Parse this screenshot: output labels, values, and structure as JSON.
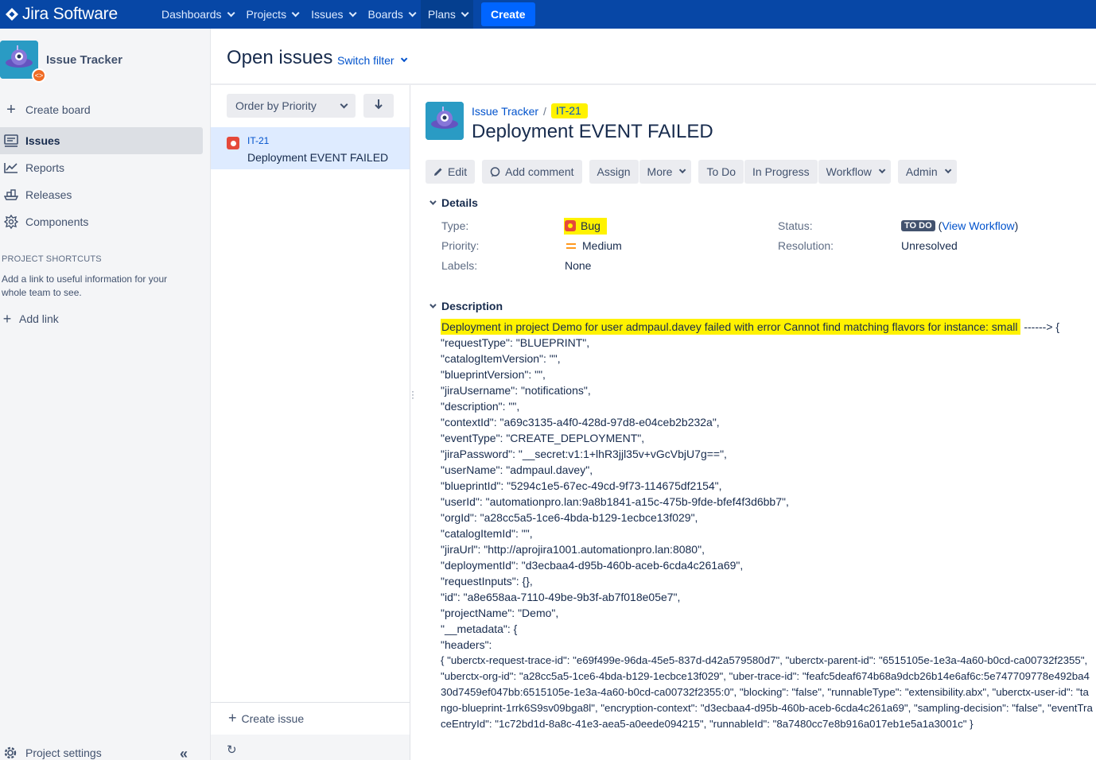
{
  "nav": {
    "brand": "Jira Software",
    "items": [
      {
        "label": "Dashboards"
      },
      {
        "label": "Projects"
      },
      {
        "label": "Issues"
      },
      {
        "label": "Boards"
      },
      {
        "label": "Plans"
      }
    ],
    "create_label": "Create"
  },
  "sidebar": {
    "project_name": "Issue Tracker",
    "create_board": "Create board",
    "items": [
      {
        "label": "Issues",
        "icon": "issues-icon"
      },
      {
        "label": "Reports",
        "icon": "reports-icon"
      },
      {
        "label": "Releases",
        "icon": "releases-icon"
      },
      {
        "label": "Components",
        "icon": "components-icon"
      }
    ],
    "shortcuts_title": "PROJECT SHORTCUTS",
    "shortcuts_text": "Add a link to useful information for your whole team to see.",
    "add_link": "Add link",
    "project_settings": "Project settings"
  },
  "header": {
    "title": "Open issues",
    "switch_filter": "Switch filter"
  },
  "list": {
    "order_by": "Order by Priority",
    "issues": [
      {
        "key": "IT-21",
        "summary": "Deployment EVENT FAILED"
      }
    ],
    "create_issue": "Create issue"
  },
  "detail": {
    "breadcrumb_project": "Issue Tracker",
    "key": "IT-21",
    "title": "Deployment EVENT FAILED",
    "toolbar": {
      "edit": "Edit",
      "add_comment": "Add comment",
      "assign": "Assign",
      "more": "More",
      "todo": "To Do",
      "in_progress": "In Progress",
      "workflow": "Workflow",
      "admin": "Admin"
    },
    "details_title": "Details",
    "fields": {
      "type_label": "Type:",
      "type_value": "Bug",
      "priority_label": "Priority:",
      "priority_value": "Medium",
      "labels_label": "Labels:",
      "labels_value": "None",
      "status_label": "Status:",
      "status_value": "TO DO",
      "view_workflow": "View Workflow",
      "resolution_label": "Resolution:",
      "resolution_value": "Unresolved"
    },
    "description_title": "Description",
    "description_first": "Deployment in project Demo for user admpaul.davey failed with error Cannot find matching flavors for instance: small",
    "description_first_tail": " ------> {",
    "description_lines": [
      "\"requestType\": \"BLUEPRINT\",",
      "\"catalogItemVersion\": \"\",",
      "\"blueprintVersion\": \"\",",
      "\"jiraUsername\": \"notifications\",",
      "\"description\": \"\",",
      "\"contextId\": \"a69c3135-a4f0-428d-97d8-e04ceb2b232a\",",
      "\"eventType\": \"CREATE_DEPLOYMENT\",",
      "\"jiraPassword\": \"__secret:v1:1+lhR3jjl35v+vGcVbjU7g==\",",
      "\"userName\": \"admpaul.davey\",",
      "\"blueprintId\": \"5294c1e5-67ec-49cd-9f73-114675df2154\",",
      "\"userId\": \"automationpro.lan:9a8b1841-a15c-475b-9fde-bfef4f3d6bb7\",",
      "\"orgId\": \"a28cc5a5-1ce6-4bda-b129-1ecbce13f029\",",
      "\"catalogItemId\": \"\",",
      "\"jiraUrl\": \"http://aprojira1001.automationpro.lan:8080\",",
      "\"deploymentId\": \"d3ecbaa4-d95b-460b-aceb-6cda4c261a69\",",
      "\"requestInputs\": {},",
      "\"id\": \"a8e658aa-7110-49be-9b3f-ab7f018e05e7\",",
      "\"projectName\": \"Demo\",",
      "\"__metadata\": {",
      "\"headers\":"
    ],
    "description_headers": "{ \"uberctx-request-trace-id\": \"e69f499e-96da-45e5-837d-d42a579580d7\", \"uberctx-parent-id\": \"6515105e-1e3a-4a60-b0cd-ca00732f2355\", \"uberctx-org-id\": \"a28cc5a5-1ce6-4bda-b129-1ecbce13f029\", \"uber-trace-id\": \"feafc5deaf674b68a9dcb26b14e6af6c:5e747709778e492ba430d7459ef047bb:6515105e-1e3a-4a60-b0cd-ca00732f2355:0\", \"blocking\": \"false\", \"runnableType\": \"extensibility.abx\", \"uberctx-user-id\": \"tango-blueprint-1rrk6S9sv09bga8l\", \"encryption-context\": \"d3ecbaa4-d95b-460b-aceb-6cda4c261a69\", \"sampling-decision\": \"false\", \"eventTraceEntryId\": \"1c72bd1d-8a8c-41e3-aea5-a0eede094215\", \"runnableId\": \"8a7480cc7e8b916a017eb1e5a1a3001c\" }"
  }
}
